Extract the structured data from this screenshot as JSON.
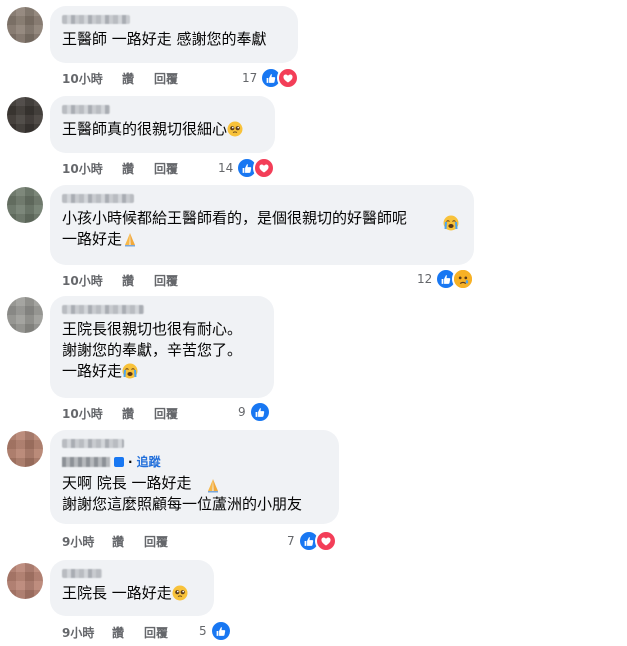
{
  "actions": {
    "like": "讚",
    "reply": "回覆"
  },
  "follow_label": "追蹤",
  "comments": [
    {
      "lines": "王醫師 一路好走 感謝您的奉獻",
      "time": "10小時",
      "count": "17"
    },
    {
      "lines": "王醫師真的很親切很細心",
      "time": "10小時",
      "count": "14"
    },
    {
      "lines": "小孩小時候都給王醫師看的，是個很親切的好醫師呢\n一路好走",
      "time": "10小時",
      "count": "12"
    },
    {
      "lines": "王院長很親切也很有耐心。\n謝謝您的奉獻，辛苦您了。\n一路好走",
      "time": "10小時",
      "count": "9"
    },
    {
      "lines": "天啊 院長 一路好走\n謝謝您這麼照顧每一位蘆洲的小朋友",
      "time": "9小時",
      "count": "7"
    },
    {
      "lines": "王院長 一路好走",
      "time": "9小時",
      "count": "5"
    }
  ]
}
